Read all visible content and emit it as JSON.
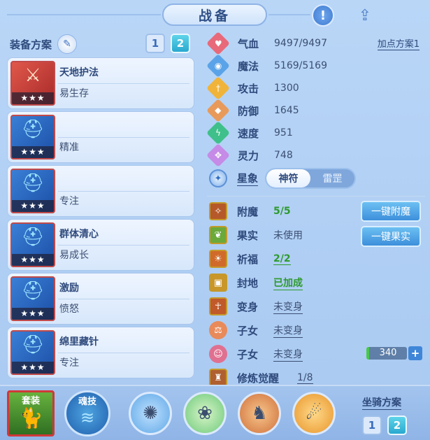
{
  "window": {
    "title": "战备",
    "alert_icon": "exclamation-icon",
    "share_icon": "share-icon"
  },
  "equip_panel": {
    "label": "装备方案",
    "plan_buttons": [
      "1",
      "2"
    ],
    "items": [
      {
        "name": "天地护法",
        "sub": "易生存",
        "stars": "★★★",
        "icon": "sword-icon"
      },
      {
        "name": "",
        "sub": "精准",
        "stars": "★★★",
        "icon": "helm-icon"
      },
      {
        "name": "",
        "sub": "专注",
        "stars": "★★★",
        "icon": "helm-icon"
      },
      {
        "name": "群体清心",
        "sub": "易成长",
        "stars": "★★★",
        "icon": "helm-icon"
      },
      {
        "name": "激励",
        "sub": "愤怒",
        "stars": "★★★",
        "icon": "helm-icon"
      },
      {
        "name": "绵里藏针",
        "sub": "专注",
        "stars": "★★★",
        "icon": "helm-icon"
      }
    ]
  },
  "stats": {
    "plan_link": "加点方案1",
    "rows": [
      {
        "label": "气血",
        "value": "9497/9497",
        "color": "#e86a7a",
        "icon": "heart-icon"
      },
      {
        "label": "魔法",
        "value": "5169/5169",
        "color": "#5aa3e8",
        "icon": "mana-icon"
      },
      {
        "label": "攻击",
        "value": "1300",
        "color": "#f0b43a",
        "icon": "attack-icon"
      },
      {
        "label": "防御",
        "value": "1645",
        "color": "#e89a5a",
        "icon": "shield-icon"
      },
      {
        "label": "速度",
        "value": "951",
        "color": "#3fc08a",
        "icon": "speed-icon"
      },
      {
        "label": "灵力",
        "value": "748",
        "color": "#c58be6",
        "icon": "spirit-icon"
      }
    ],
    "star": {
      "label": "星象",
      "options": [
        "神符",
        "雷罡"
      ],
      "selected": "神符"
    }
  },
  "enhance": {
    "rows": [
      {
        "label": "附魔",
        "value": "5/5",
        "style": "green",
        "color": "#b5592a"
      },
      {
        "label": "果实",
        "value": "未使用",
        "style": "plain",
        "color": "#6aa93a"
      },
      {
        "label": "祈福",
        "value": "2/2",
        "style": "green",
        "color": "#d06a2a"
      },
      {
        "label": "封地",
        "value": "已加成",
        "style": "green",
        "color": "#c9962a"
      },
      {
        "label": "变身",
        "value": "未变身",
        "style": "",
        "color": "#c05a2a"
      },
      {
        "label": "子女",
        "value": "未变身",
        "style": "",
        "color": "#e88a5a"
      },
      {
        "label": "子女",
        "value": "未变身",
        "style": "",
        "color": "#e07090"
      },
      {
        "label": "修炼觉醒",
        "value": "1/8",
        "style": "",
        "color": "#b06030"
      }
    ],
    "buttons": {
      "enchant": "一键附魔",
      "fruit": "一键果实"
    },
    "spirit_value": "340"
  },
  "bottom": {
    "suit_label": "套装",
    "soul_label": "魂技",
    "mount_label": "坐骑方案",
    "mount_buttons": [
      "1",
      "2"
    ],
    "pets": [
      {
        "icon": "pet-1-icon",
        "color": "#5fa8e6"
      },
      {
        "icon": "pet-2-icon",
        "color": "#6cc97a"
      },
      {
        "icon": "pet-3-icon",
        "color": "#d0703a"
      },
      {
        "icon": "pet-4-icon",
        "color": "#e8952a"
      }
    ]
  }
}
